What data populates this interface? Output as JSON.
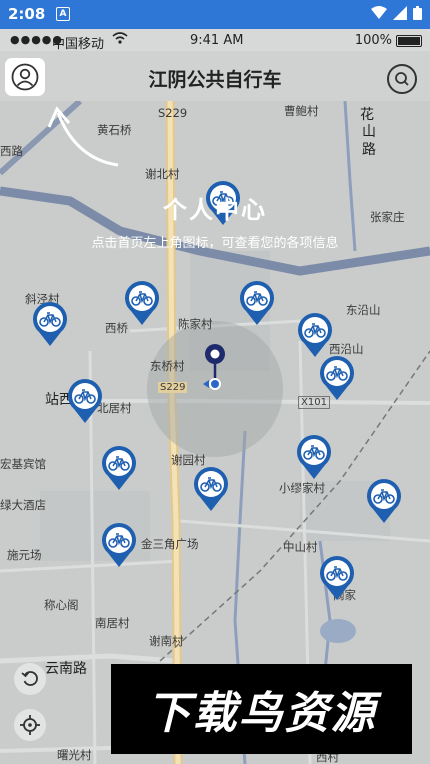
{
  "android_status": {
    "time": "2:08",
    "notif_icon": "A"
  },
  "ios_status": {
    "dots": "●●●●●",
    "carrier": "中国移动",
    "clock": "9:41 AM",
    "battery": "100%"
  },
  "header": {
    "title": "江阴公共自行车",
    "profile_icon": "person-icon",
    "search_icon": "search-icon"
  },
  "hint": {
    "title": "个人中心",
    "description": "点击首页左上角图标，可查看您的各项信息"
  },
  "map_labels": {
    "l1": "S229",
    "l2": "曹鲍村",
    "l3": "花",
    "l4": "山",
    "l5": "路",
    "l6": "黄石桥",
    "l7": "西路",
    "l8": "谢北村",
    "l9": "张家庄",
    "l10": "斜泾村",
    "l11": "西桥",
    "l12": "陈家村",
    "l13": "东沿山",
    "l14": "西沿山",
    "l15": "东桥村",
    "l16": "S229",
    "l17": "站西",
    "l18": "北居村",
    "l19": "X101",
    "l20": "谢园村",
    "l21": "宏基宾馆",
    "l22": "小缪家村",
    "l23": "绿大酒店",
    "l24": "金三角广场",
    "l25": "中山村",
    "l26": "施元场",
    "l27": "称心阁",
    "l28": "阚家",
    "l29": "南居村",
    "l30": "谢南村",
    "l31": "云南路",
    "l32": "曙光村",
    "l33": "西村"
  },
  "watermark": "下载鸟资源"
}
